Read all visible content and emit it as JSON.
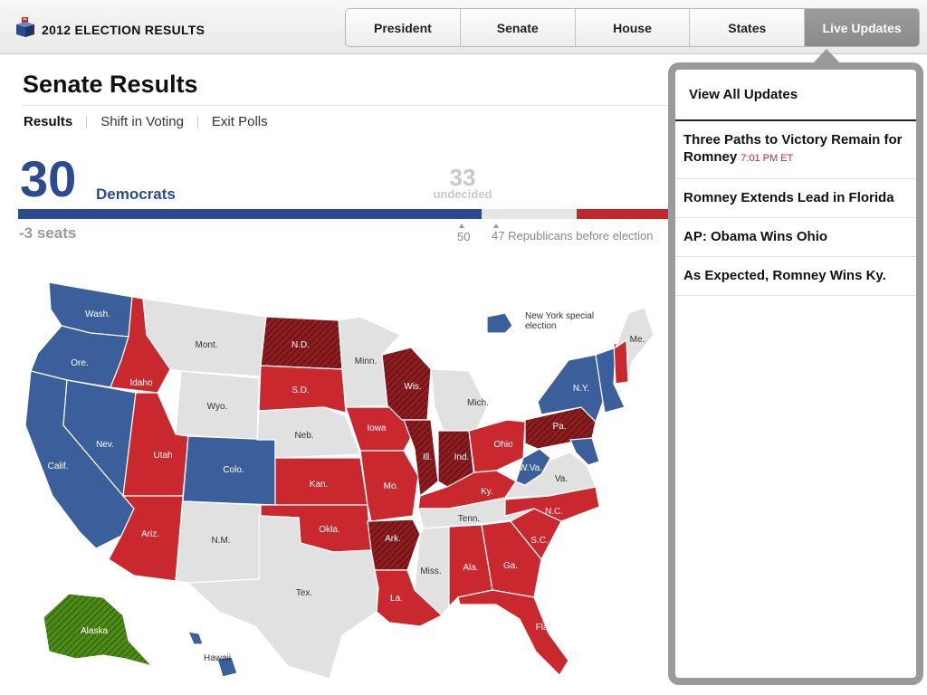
{
  "app": {
    "title": "2012 ELECTION RESULTS",
    "logo_icon": "ballot-box-icon"
  },
  "nav": {
    "tabs": [
      {
        "label": "President",
        "active": false
      },
      {
        "label": "Senate",
        "active": false
      },
      {
        "label": "House",
        "active": false
      },
      {
        "label": "States",
        "active": false
      },
      {
        "label": "Live Updates",
        "active": true
      }
    ]
  },
  "page": {
    "title": "Senate Results",
    "subnav": [
      {
        "label": "Results",
        "current": true
      },
      {
        "label": "Shift in Voting",
        "current": false
      },
      {
        "label": "Exit Polls",
        "current": false
      }
    ]
  },
  "tally": {
    "dem_count": "30",
    "dem_label": "Democrats",
    "undecided_count": "33",
    "undecided_label": "undecided",
    "seat_change": "-3 seats",
    "majority_marker": "50",
    "rep_before": "47 Republicans before election",
    "colors": {
      "dem": "#2b4b8e",
      "rep": "#c1272d",
      "undecided": "#e6e6e6"
    }
  },
  "map": {
    "legend_note": "New York special election",
    "colors": {
      "dem": "#3a5f9a",
      "rep": "#c8282e",
      "none": "#e1e1e1",
      "rep_hatched": "#8b1c20",
      "other_hatched": "#4d8a18"
    },
    "states": [
      {
        "label": "Wash.",
        "party": "dem"
      },
      {
        "label": "Ore.",
        "party": "dem"
      },
      {
        "label": "Calif.",
        "party": "dem"
      },
      {
        "label": "Nev.",
        "party": "dem"
      },
      {
        "label": "Idaho",
        "party": "rep"
      },
      {
        "label": "Mont.",
        "party": "none"
      },
      {
        "label": "Wyo.",
        "party": "none"
      },
      {
        "label": "Utah",
        "party": "rep"
      },
      {
        "label": "Ariz.",
        "party": "rep"
      },
      {
        "label": "Colo.",
        "party": "dem"
      },
      {
        "label": "N.M.",
        "party": "none"
      },
      {
        "label": "N.D.",
        "party": "rep_hatched"
      },
      {
        "label": "S.D.",
        "party": "rep"
      },
      {
        "label": "Neb.",
        "party": "none"
      },
      {
        "label": "Kan.",
        "party": "rep"
      },
      {
        "label": "Okla.",
        "party": "rep"
      },
      {
        "label": "Tex.",
        "party": "none"
      },
      {
        "label": "Minn.",
        "party": "none"
      },
      {
        "label": "Iowa",
        "party": "rep"
      },
      {
        "label": "Mo.",
        "party": "rep"
      },
      {
        "label": "Ark.",
        "party": "rep_hatched"
      },
      {
        "label": "La.",
        "party": "rep"
      },
      {
        "label": "Wis.",
        "party": "rep_hatched"
      },
      {
        "label": "Ill.",
        "party": "rep_hatched"
      },
      {
        "label": "Mich.",
        "party": "none"
      },
      {
        "label": "Ind.",
        "party": "rep_hatched"
      },
      {
        "label": "Ohio",
        "party": "rep"
      },
      {
        "label": "Ky.",
        "party": "rep"
      },
      {
        "label": "Tenn.",
        "party": "none"
      },
      {
        "label": "Miss.",
        "party": "none"
      },
      {
        "label": "Ala.",
        "party": "rep"
      },
      {
        "label": "Ga.",
        "party": "rep"
      },
      {
        "label": "Fla.",
        "party": "rep"
      },
      {
        "label": "S.C.",
        "party": "rep"
      },
      {
        "label": "N.C.",
        "party": "rep"
      },
      {
        "label": "Va.",
        "party": "none"
      },
      {
        "label": "W.Va.",
        "party": "dem"
      },
      {
        "label": "Pa.",
        "party": "rep_hatched"
      },
      {
        "label": "N.Y.",
        "party": "dem"
      },
      {
        "label": "Me.",
        "party": "none"
      },
      {
        "label": "Alaska",
        "party": "other_hatched"
      },
      {
        "label": "Hawaii",
        "party": "dem"
      }
    ]
  },
  "live_updates": {
    "view_all_label": "View All Updates",
    "items": [
      {
        "headline": "Three Paths to Victory Remain for Romney",
        "time": "7:01 PM ET"
      },
      {
        "headline": "Romney Extends Lead in Florida",
        "time": ""
      },
      {
        "headline": "AP: Obama Wins Ohio",
        "time": ""
      },
      {
        "headline": "As Expected, Romney Wins Ky.",
        "time": ""
      }
    ]
  }
}
